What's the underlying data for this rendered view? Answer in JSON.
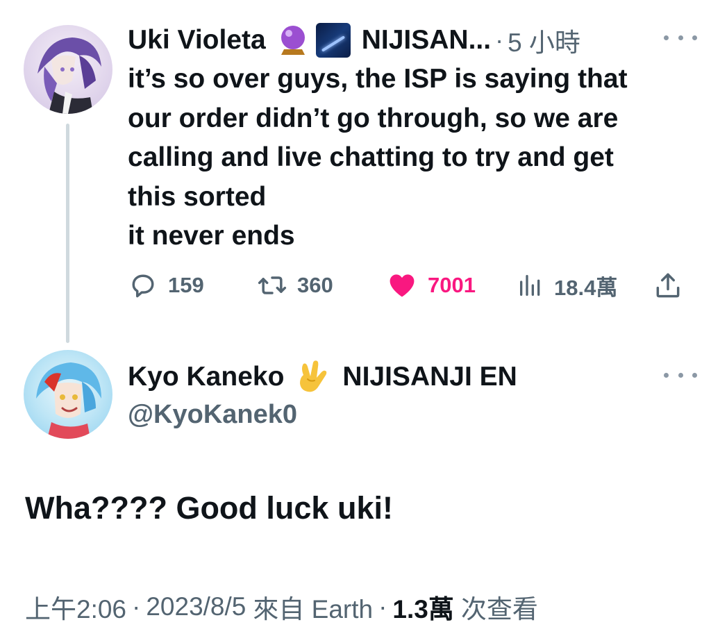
{
  "parent_tweet": {
    "display_name": "Uki Violeta",
    "emoji_1": "crystal-ball-emoji",
    "emoji_2": "milky-way-emoji",
    "affiliation": "NIJISAN...",
    "separator": "·",
    "time_ago": "5 小時",
    "body": "it’s so over guys, the ISP is saying that\nour order didn’t go through, so we are\ncalling and live chatting to try and get\nthis sorted\nit never ends",
    "actions": {
      "replies": "159",
      "retweets": "360",
      "likes": "7001",
      "views": "18.4萬"
    },
    "liked": true,
    "like_color": "#f91880"
  },
  "reply_tweet": {
    "display_name": "Kyo Kaneko",
    "emoji": "love-you-gesture-emoji",
    "affiliation": "NIJISANJI EN",
    "handle": "@KyoKanek0",
    "text": "Wha???? Good luck uki!",
    "meta": {
      "time": "上午2:06",
      "separator": "·",
      "date": "2023/8/5",
      "source": "來自 Earth",
      "views_count": "1.3萬",
      "views_label": "次查看"
    }
  },
  "colors": {
    "text_primary": "#0f1419",
    "text_secondary": "#536471",
    "thread_line": "#cfd9de",
    "like_pink": "#f91880"
  }
}
